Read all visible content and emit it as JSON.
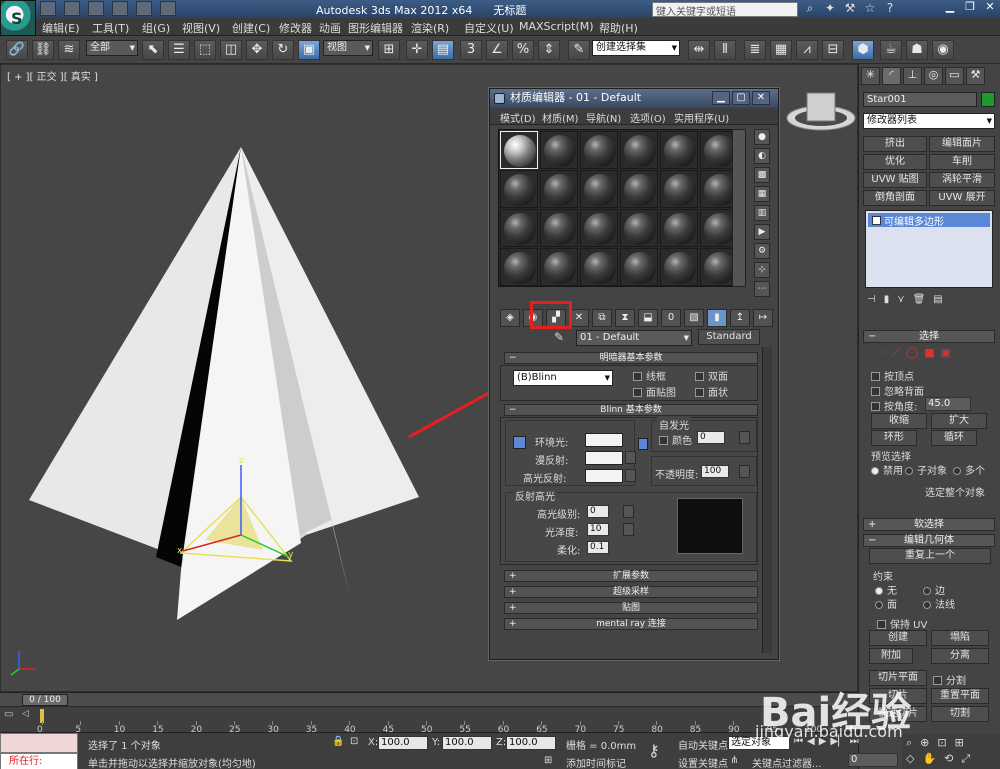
{
  "titlebar": {
    "app_title": "Autodesk 3ds Max  2012 x64",
    "file_name": "无标题",
    "search_placeholder": "键入关键字或短语"
  },
  "menu": [
    "编辑(E)",
    "工具(T)",
    "组(G)",
    "视图(V)",
    "创建(C)",
    "修改器",
    "动画",
    "图形编辑器",
    "渲染(R)",
    "自定义(U)",
    "MAXScript(M)",
    "帮助(H)"
  ],
  "toolbar": {
    "selection_filter": "全部",
    "ref_coord": "视图",
    "named_selection": "创建选择集"
  },
  "viewport": {
    "label": "[ + ][ 正交 ][ 真实 ]"
  },
  "material_editor": {
    "title": "材质编辑器 - 01 - Default",
    "menu": [
      "模式(D)",
      "材质(M)",
      "导航(N)",
      "选项(O)",
      "实用程序(U)"
    ],
    "material_name": "01 - Default",
    "material_type": "Standard",
    "shader_rollout": "明暗器基本参数",
    "shader": "(B)Blinn",
    "shader_options": [
      "线框",
      "双面",
      "面贴图",
      "面状"
    ],
    "blinn_rollout": "Blinn 基本参数",
    "self_illum_group": "自发光",
    "self_illum_color_label": "颜色",
    "self_illum_value": "0",
    "ambient_label": "环境光:",
    "diffuse_label": "漫反射:",
    "specular_label": "高光反射:",
    "opacity_label": "不透明度:",
    "opacity_value": "100",
    "spec_group": "反射高光",
    "spec_level_label": "高光级别:",
    "spec_level_value": "0",
    "gloss_label": "光泽度:",
    "gloss_value": "10",
    "soften_label": "柔化:",
    "soften_value": "0.1",
    "rollouts": [
      "扩展参数",
      "超级采样",
      "贴图",
      "mental ray 连接"
    ]
  },
  "command_panel": {
    "object_name": "Star001",
    "object_color": "#1f9a2e",
    "modifier_list": "修改器列表",
    "modifier_buttons": [
      "挤出",
      "编辑面片",
      "优化",
      "车削",
      "UVW 贴图",
      "涡轮平滑",
      "倒角剖面",
      "UVW 展开"
    ],
    "stack_item": "可编辑多边形",
    "selection_rollout": "选择",
    "by_vertex": "按顶点",
    "ignore_backfacing": "忽略背面",
    "by_angle": "按角度:",
    "angle_value": "45.0",
    "shrink": "收缩",
    "grow": "扩大",
    "ring": "环形",
    "loop": "循环",
    "preview_group": "预览选择",
    "preview_options": [
      "禁用",
      "子对象",
      "多个"
    ],
    "selected_text": "选定整个对象",
    "soft_selection": "软选择",
    "edit_geometry": "编辑几何体",
    "repeat_last": "重复上一个",
    "constraints_group": "约束",
    "constraints": [
      "无",
      "边",
      "面",
      "法线"
    ],
    "preserve_uv": "保持 UV",
    "create": "创建",
    "collapse": "塌陷",
    "attach": "附加",
    "detach": "分离",
    "slice_plane": "切片平面",
    "split": "分割",
    "slice": "切片",
    "reset_plane": "重置平面",
    "quickslice": "快速切片",
    "cut": "切割"
  },
  "timeline": {
    "frame_indicator": "0 / 100",
    "ticks": [
      "0",
      "5",
      "10",
      "15",
      "20",
      "25",
      "30",
      "35",
      "40",
      "45",
      "50",
      "55",
      "60",
      "65",
      "70",
      "75",
      "80",
      "85",
      "90",
      "95",
      "100"
    ]
  },
  "status": {
    "selected": "选择了 1 个对象",
    "prompt": "单击并拖动以选择并缩放对象(均匀地)",
    "running": "所在行:",
    "x_label": "X:",
    "x_value": "100.0",
    "y_label": "Y:",
    "y_value": "100.0",
    "z_label": "Z:",
    "z_value": "100.0",
    "grid": "栅格 = 0.0mm",
    "auto_key": "自动关键点",
    "selected_set": "选定对象",
    "set_key": "设置关键点",
    "key_filters": "关键点过滤器...",
    "add_time_tag": "添加时间标记",
    "frame": "0"
  },
  "watermark": {
    "brand": "Bai经验",
    "url": "jingyan.baidu.com"
  },
  "colors": {
    "highlight": "#e42020",
    "selection_blue": "#5a87d6"
  }
}
